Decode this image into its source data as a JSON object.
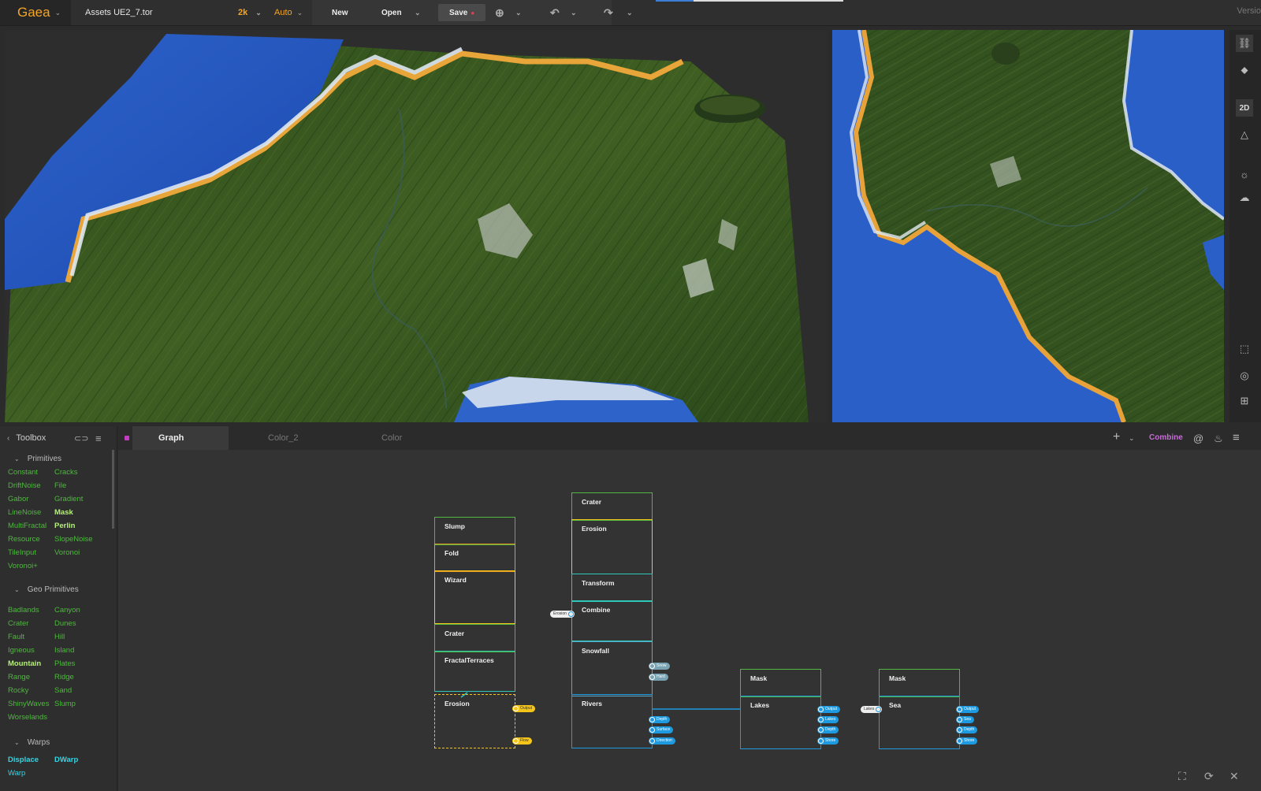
{
  "app": {
    "logo": "Gaea",
    "file_title": "Assets UE2_7.tor",
    "resolution": "2k",
    "build_mode": "Auto",
    "new_label": "New",
    "open_label": "Open",
    "save_label": "Save",
    "version_label": "Versio"
  },
  "right_toolbar": {
    "view_mode": "2D"
  },
  "toolbox": {
    "title": "Toolbox",
    "categories": [
      {
        "name": "Primitives",
        "items": [
          "Constant",
          "Cracks",
          "DriftNoise",
          "File",
          "Gabor",
          "Gradient",
          "LineNoise",
          "Mask",
          "MultiFractal",
          "Perlin",
          "Resource",
          "SlopeNoise",
          "TileInput",
          "Voronoi",
          "Voronoi+"
        ]
      },
      {
        "name": "Geo Primitives",
        "items": [
          "Badlands",
          "Canyon",
          "Crater",
          "Dunes",
          "Fault",
          "Hill",
          "Igneous",
          "Island",
          "Mountain",
          "Plates",
          "Range",
          "Ridge",
          "Rocky",
          "Sand",
          "ShinyWaves",
          "Slump",
          "Worselands"
        ]
      },
      {
        "name": "Warps",
        "items": [
          "Displace",
          "DWarp",
          "Warp"
        ]
      }
    ]
  },
  "graph_panel": {
    "tabs": [
      "Graph",
      "Color_2",
      "Color"
    ],
    "active_tab": "Graph",
    "combine_label": "Combine"
  },
  "graph": {
    "col1": [
      "Slump",
      "Fold",
      "Wizard",
      "Crater",
      "FractalTerraces",
      "Erosion"
    ],
    "col1_ports": [
      "Output",
      "Flow"
    ],
    "col2": [
      "Crater",
      "Erosion",
      "Transform",
      "Combine",
      "Snowfall",
      "Rivers"
    ],
    "col2_in_label": "Erosion",
    "snowfall_ports": [
      "Snow",
      "Hard"
    ],
    "rivers_ports": [
      "Depth",
      "Surface",
      "Direction"
    ],
    "col3": [
      "Mask",
      "Lakes"
    ],
    "lakes_ports": [
      "Output",
      "Lakes",
      "Depth",
      "Shore"
    ],
    "col4": [
      "Mask",
      "Sea"
    ],
    "col4_in_label": "Lakes",
    "sea_ports": [
      "Output",
      "Sea",
      "Depth",
      "Shore"
    ]
  },
  "colors": {
    "accent_orange": "#f5a524",
    "primitive_green": "#4fb83f",
    "highlight_green": "#b6f07a",
    "warp_cyan": "#33d6e6",
    "combine_purple": "#c86ad9",
    "node_green": "#4fb83f",
    "node_yellow": "#f5c51a",
    "node_teal": "#2ec8b8",
    "node_blue": "#1d9ae0"
  }
}
